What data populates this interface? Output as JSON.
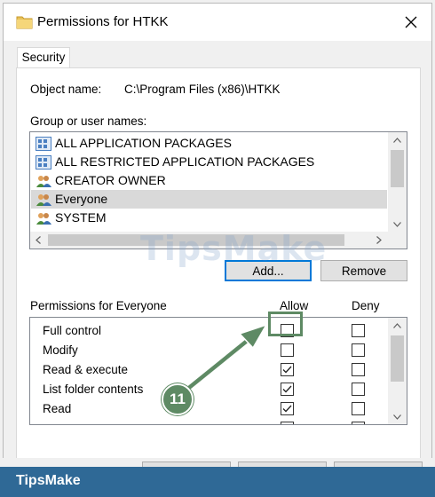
{
  "window": {
    "title": "Permissions for HTKK"
  },
  "tabs": [
    {
      "label": "Security"
    }
  ],
  "object_name": {
    "label": "Object name:",
    "value": "C:\\Program Files (x86)\\HTKK"
  },
  "groups": {
    "label": "Group or user names:",
    "items": [
      {
        "label": "ALL APPLICATION PACKAGES",
        "icon": "app-package-icon"
      },
      {
        "label": "ALL RESTRICTED APPLICATION PACKAGES",
        "icon": "app-package-icon"
      },
      {
        "label": "CREATOR OWNER",
        "icon": "users-icon"
      },
      {
        "label": "Everyone",
        "icon": "users-icon",
        "selected": true
      },
      {
        "label": "SYSTEM",
        "icon": "users-icon"
      }
    ],
    "add_label": "Add...",
    "remove_label": "Remove"
  },
  "permissions": {
    "header": "Permissions for Everyone",
    "allow_header": "Allow",
    "deny_header": "Deny",
    "rows": [
      {
        "name": "Full control",
        "allow": false,
        "deny": false
      },
      {
        "name": "Modify",
        "allow": false,
        "deny": false
      },
      {
        "name": "Read & execute",
        "allow": true,
        "deny": false
      },
      {
        "name": "List folder contents",
        "allow": true,
        "deny": false
      },
      {
        "name": "Read",
        "allow": true,
        "deny": false
      }
    ]
  },
  "annotation": {
    "step": "11"
  },
  "watermark": "TipsMake",
  "brand": "TipsMake",
  "colors": {
    "accent": "#0078d7",
    "annotation": "#5e8a64",
    "brand_bar": "#2f6996",
    "selected_row": "#d9d9d9"
  }
}
